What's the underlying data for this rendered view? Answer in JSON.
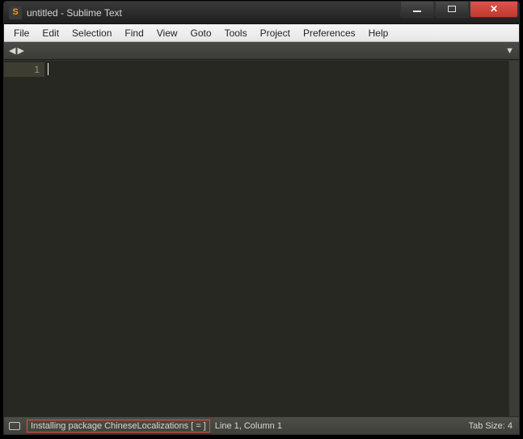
{
  "window": {
    "title": "untitled - Sublime Text"
  },
  "menubar": {
    "items": [
      {
        "label": "File"
      },
      {
        "label": "Edit"
      },
      {
        "label": "Selection"
      },
      {
        "label": "Find"
      },
      {
        "label": "View"
      },
      {
        "label": "Goto"
      },
      {
        "label": "Tools"
      },
      {
        "label": "Project"
      },
      {
        "label": "Preferences"
      },
      {
        "label": "Help"
      }
    ]
  },
  "tabstrip": {
    "prev": "◀",
    "next": "▶",
    "dropdown": "▼"
  },
  "editor": {
    "gutter": {
      "line1": "1"
    }
  },
  "statusbar": {
    "message": "Installing package ChineseLocalizations [  =     ]",
    "position": "Line 1, Column 1",
    "tab_size": "Tab Size: 4"
  },
  "win_controls": {
    "close_glyph": "✕"
  }
}
